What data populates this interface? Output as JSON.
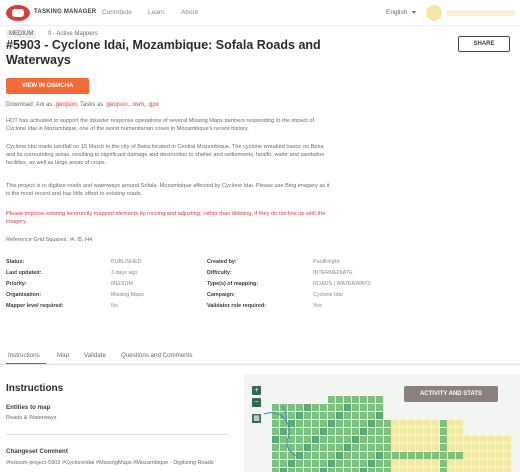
{
  "header": {
    "brand": "TASKING MANAGER",
    "nav": [
      {
        "label": "Contribute"
      },
      {
        "label": "Learn"
      },
      {
        "label": "About"
      }
    ],
    "language": "English"
  },
  "project": {
    "priority_badge": "MEDIUM",
    "active_mappers": "0 - Active Mappers",
    "title": "#5903 - Cyclone Idai, Mozambique: Sofala Roads and Waterways",
    "share_label": "SHARE",
    "osmcha_label": "VIEW IN OSMCHA",
    "download_prefix": "Download: Aoi as",
    "download_aoi_geojson": ".geojson",
    "download_tasks_prefix": ", Tasks as",
    "download_tasks_geojson": ".geojson",
    "download_osm": ".osm",
    "download_gpx": ".gpx",
    "description": [
      "HOT has activated to support the disaster response operations of several Missing Maps partners responding to the impact of Cyclone Idai in Mozambique, one of the worst humanitarian crises in Mozambique's recent history.",
      "Cyclone Idai made landfall on 15 March in the city of Beira located in Central Mozambique. The cyclone wreaked havoc on Beira and its surrounding areas, resulting in significant damage and destruction to shelter and settlements, health, water and sanitation facilities, as well as large areas of crops.",
      "This project is to digitize roads and waterways around Sofala, Mozambique affected by Cyclone Idai. Please use Bing imagery as it is the most recent and has little offset to existing roads."
    ],
    "warning": "Please improve existing incorrectly mapped elements by moving and adjusting, rather than deleting, if they do not line up with the imagery.",
    "reference": "Reference Grid Squares: I4, I5, H4"
  },
  "info": {
    "left": [
      {
        "label": "Status:",
        "value": "PUBLISHED"
      },
      {
        "label": "Last updated:",
        "value": "3 days ago"
      },
      {
        "label": "Priority:",
        "value": "MEDIUM"
      },
      {
        "label": "Organisation:",
        "value": "Missing Maps"
      },
      {
        "label": "Mapper level required:",
        "value": "No"
      }
    ],
    "right": [
      {
        "label": "Created by:",
        "value": "PaulKnight"
      },
      {
        "label": "Difficulty:",
        "value": "INTERMEDIATE"
      },
      {
        "label": "Type(s) of mapping:",
        "value": "ROADS | WATERWAYS"
      },
      {
        "label": "Campaign:",
        "value": "Cyclone Idai"
      },
      {
        "label": "Validator role required:",
        "value": "Yes"
      }
    ]
  },
  "tabs": [
    {
      "label": "Instructions"
    },
    {
      "label": "Map"
    },
    {
      "label": "Validate"
    },
    {
      "label": "Questions and Comments"
    }
  ],
  "instructions": {
    "heading": "Instructions",
    "entities_label": "Entities to map",
    "entities_value": "Roads & Waterways",
    "changeset_label": "Changeset Comment",
    "changeset_value": "#hotosm-project-5903 #CycloneIdai #MissingMaps #Mozambique - Digitizing Roads"
  },
  "map": {
    "activity_label": "ACTIVITY AND STATS",
    "zoom_in": "+",
    "zoom_out": "−",
    "colors": {
      "mapped": "#7fbf7f",
      "validated": "#5ea776",
      "unmapped": "#f2e8a8",
      "accent": "#d73f3f"
    }
  }
}
